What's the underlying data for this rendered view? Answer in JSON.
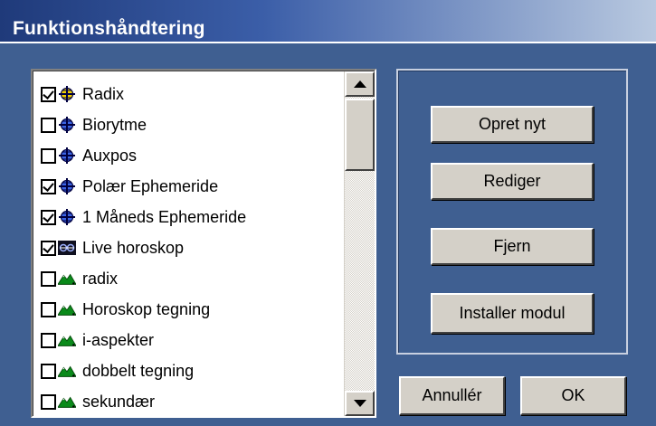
{
  "window": {
    "title": "Funktionshåndtering"
  },
  "list": {
    "items": [
      {
        "label": "Radix",
        "checked": true,
        "icon": "crosshair-globe-yellow-icon"
      },
      {
        "label": "Biorytme",
        "checked": false,
        "icon": "crosshair-globe-blue-icon"
      },
      {
        "label": "Auxpos",
        "checked": false,
        "icon": "crosshair-globe-blue-icon"
      },
      {
        "label": "Polær Ephemeride",
        "checked": true,
        "icon": "crosshair-globe-blue-icon"
      },
      {
        "label": "1 Måneds Ephemeride",
        "checked": true,
        "icon": "crosshair-globe-blue-icon"
      },
      {
        "label": "Live horoskop",
        "checked": true,
        "icon": "live-chart-icon"
      },
      {
        "label": "radix",
        "checked": false,
        "icon": "green-mountain-icon"
      },
      {
        "label": "Horoskop tegning",
        "checked": false,
        "icon": "green-mountain-icon"
      },
      {
        "label": "i-aspekter",
        "checked": false,
        "icon": "green-mountain-icon"
      },
      {
        "label": "dobbelt tegning",
        "checked": false,
        "icon": "green-mountain-icon"
      },
      {
        "label": "sekundær",
        "checked": false,
        "icon": "green-mountain-icon"
      }
    ]
  },
  "actions": {
    "create_label": "Opret nyt",
    "edit_label": "Rediger",
    "remove_label": "Fjern",
    "install_label": "Installer modul"
  },
  "footer": {
    "cancel_label": "Annullér",
    "ok_label": "OK"
  },
  "colors": {
    "background": "#3f5f91",
    "button_face": "#d4d0c8",
    "selection": "#000080"
  }
}
